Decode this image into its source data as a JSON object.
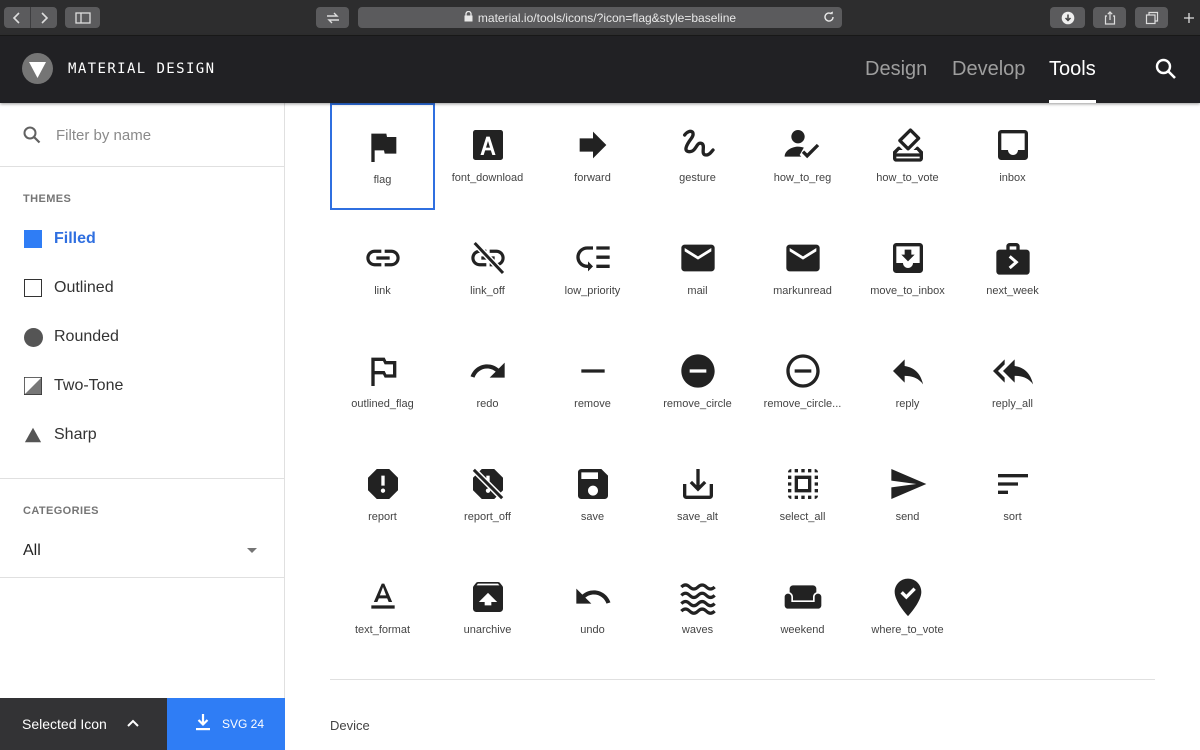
{
  "browser": {
    "url": "material.io/tools/icons/?icon=flag&style=baseline"
  },
  "header": {
    "brand": "MATERIAL DESIGN",
    "nav": [
      "Design",
      "Develop",
      "Tools"
    ],
    "active_nav": "Tools"
  },
  "sidebar": {
    "filter_placeholder": "Filter by name",
    "themes_label": "THEMES",
    "themes": [
      "Filled",
      "Outlined",
      "Rounded",
      "Two-Tone",
      "Sharp"
    ],
    "active_theme": "Filled",
    "categories_label": "CATEGORIES",
    "category_value": "All",
    "selected_icon_label": "Selected Icon",
    "download_label": "SVG 24"
  },
  "icons": [
    "flag",
    "font_download",
    "forward",
    "gesture",
    "how_to_reg",
    "how_to_vote",
    "inbox",
    "link",
    "link_off",
    "low_priority",
    "mail",
    "markunread",
    "move_to_inbox",
    "next_week",
    "outlined_flag",
    "redo",
    "remove",
    "remove_circle",
    "remove_circle...",
    "reply",
    "reply_all",
    "report",
    "report_off",
    "save",
    "save_alt",
    "select_all",
    "send",
    "sort",
    "text_format",
    "unarchive",
    "undo",
    "waves",
    "weekend",
    "where_to_vote"
  ],
  "selected_icon": "flag",
  "section_next": "Device",
  "colors": {
    "accent": "#2f6fe0",
    "download_button": "#2f7df5",
    "appbar": "#212124"
  }
}
